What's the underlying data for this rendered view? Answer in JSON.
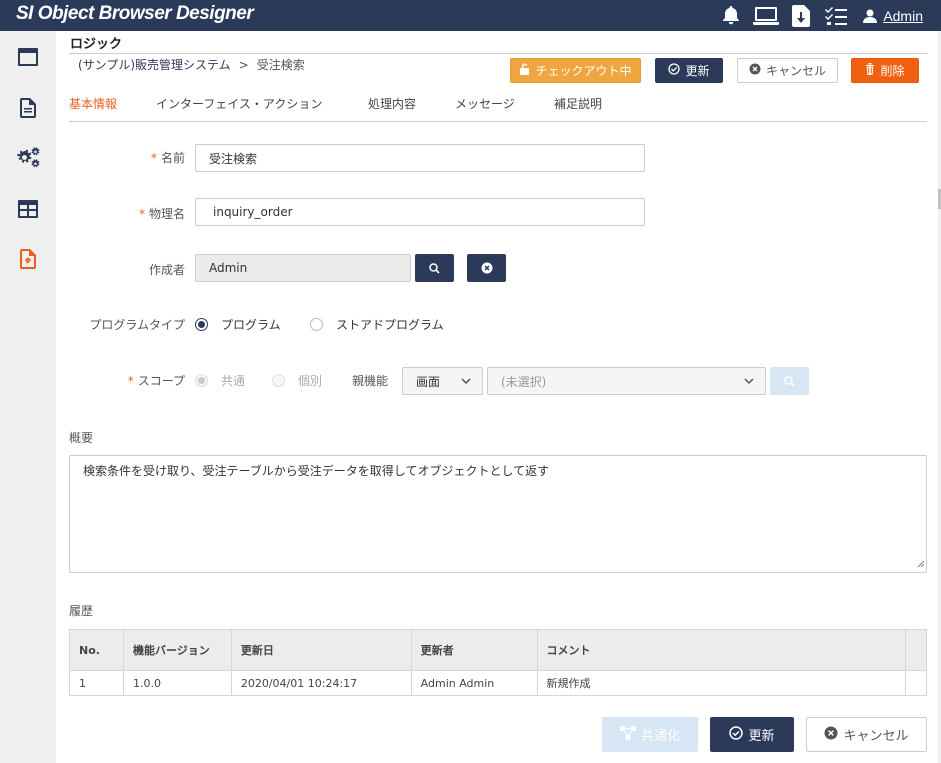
{
  "app": {
    "logo": "SI Object Browser Designer",
    "user_name": "Admin"
  },
  "colors": {
    "header": "#2c3a5a",
    "accent": "#e8601c",
    "checkout": "#f0a640",
    "delete": "#f06010"
  },
  "topbar_icons": [
    "bell-icon",
    "monitor-icon",
    "download-icon",
    "checklist-icon",
    "user-icon"
  ],
  "sidebar_icons": [
    "window-icon",
    "document-icon",
    "gears-icon",
    "table-icon",
    "code-file-icon"
  ],
  "page": {
    "title": "ロジック",
    "breadcrumb_parent": "(サンプル)販売管理システム",
    "breadcrumb_sep": ">",
    "breadcrumb_current": "受注検索"
  },
  "actions": {
    "checkout": "チェックアウト中",
    "update": "更新",
    "cancel": "キャンセル",
    "delete": "削除"
  },
  "tabs": [
    {
      "label": "基本情報",
      "active": true
    },
    {
      "label": "インターフェイス・アクション",
      "active": false
    },
    {
      "label": "処理内容",
      "active": false
    },
    {
      "label": "メッセージ",
      "active": false
    },
    {
      "label": "補足説明",
      "active": false
    }
  ],
  "form": {
    "required_mark": "*",
    "name_label": "名前",
    "name_value": "受注検索",
    "physical_label": "物理名",
    "physical_value": "inquiry_order",
    "author_label": "作成者",
    "author_value": "Admin",
    "program_type_label": "プログラムタイプ",
    "program_type_options": [
      "プログラム",
      "ストアドプログラム"
    ],
    "program_type_selected": "プログラム",
    "scope_label": "スコープ",
    "scope_options": [
      "共通",
      "個別"
    ],
    "scope_selected": "共通",
    "parent_label": "親機能",
    "parent_kind": "画面",
    "parent_select": "(未選択)",
    "summary_label": "概要",
    "summary_value": "検索条件を受け取り、受注テーブルから受注データを取得してオブジェクトとして返す"
  },
  "history": {
    "label": "履歴",
    "columns": [
      "No.",
      "機能バージョン",
      "更新日",
      "更新者",
      "コメント"
    ],
    "rows": [
      [
        "1",
        "1.0.0",
        "2020/04/01 10:24:17",
        "Admin Admin",
        "新規作成"
      ]
    ]
  },
  "bottom_actions": {
    "share": "共通化",
    "update": "更新",
    "cancel": "キャンセル"
  }
}
